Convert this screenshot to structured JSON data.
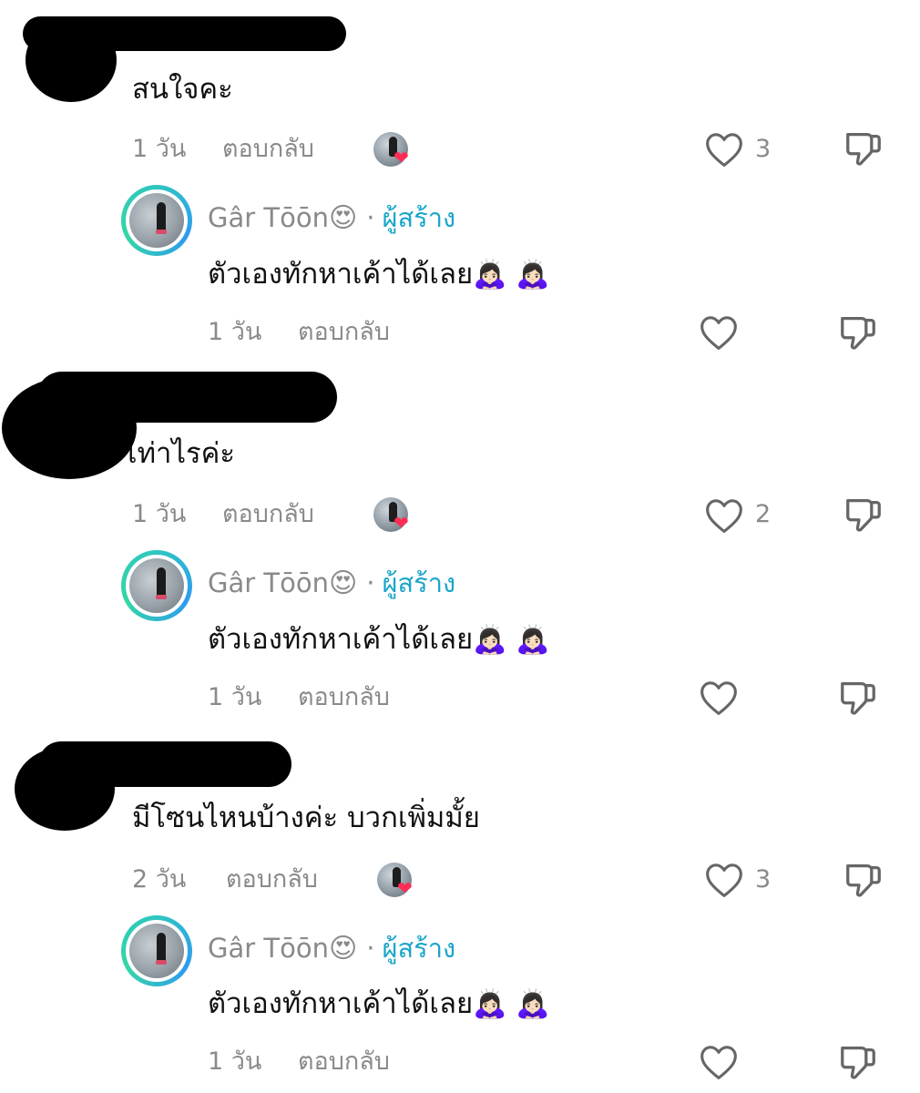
{
  "comments": [
    {
      "text": "สนใจคะ",
      "time": "1 วัน",
      "reply_label": "ตอบกลับ",
      "like_count": "3",
      "reply": {
        "name": "Gâr Tōōn",
        "name_emoji": "😍",
        "separator": "·",
        "badge": "ผู้สร้าง",
        "text": "ตัวเองทักหาเค้าได้เลย",
        "text_emoji": "🙇🏻‍♀️ 🙇🏻‍♀️",
        "time": "1 วัน",
        "reply_label": "ตอบกลับ"
      }
    },
    {
      "text": "เท่าไรค่ะ",
      "time": "1 วัน",
      "reply_label": "ตอบกลับ",
      "like_count": "2",
      "reply": {
        "name": "Gâr Tōōn",
        "name_emoji": "😍",
        "separator": "·",
        "badge": "ผู้สร้าง",
        "text": "ตัวเองทักหาเค้าได้เลย",
        "text_emoji": "🙇🏻‍♀️ 🙇🏻‍♀️",
        "time": "1 วัน",
        "reply_label": "ตอบกลับ"
      }
    },
    {
      "text": "มีโซนไหนบ้างค่ะ บวกเพิ่มมั้ย",
      "time": "2 วัน",
      "reply_label": "ตอบกลับ",
      "like_count": "3",
      "reply": {
        "name": "Gâr Tōōn",
        "name_emoji": "😍",
        "separator": "·",
        "badge": "ผู้สร้าง",
        "text": "ตัวเองทักหาเค้าได้เลย",
        "text_emoji": "🙇🏻‍♀️ 🙇🏻‍♀️",
        "time": "1 วัน",
        "reply_label": "ตอบกลับ"
      }
    }
  ],
  "colors": {
    "creator_badge": "#1aa6c9",
    "heart_badge": "#ff2d55",
    "meta_gray": "#8a8a8a",
    "avatar_ring": "#2ec6c1"
  },
  "icons": {
    "like": "heart-outline-icon",
    "dislike": "thumbs-down-icon",
    "creator_liked": "creator-liked-heart-icon"
  }
}
